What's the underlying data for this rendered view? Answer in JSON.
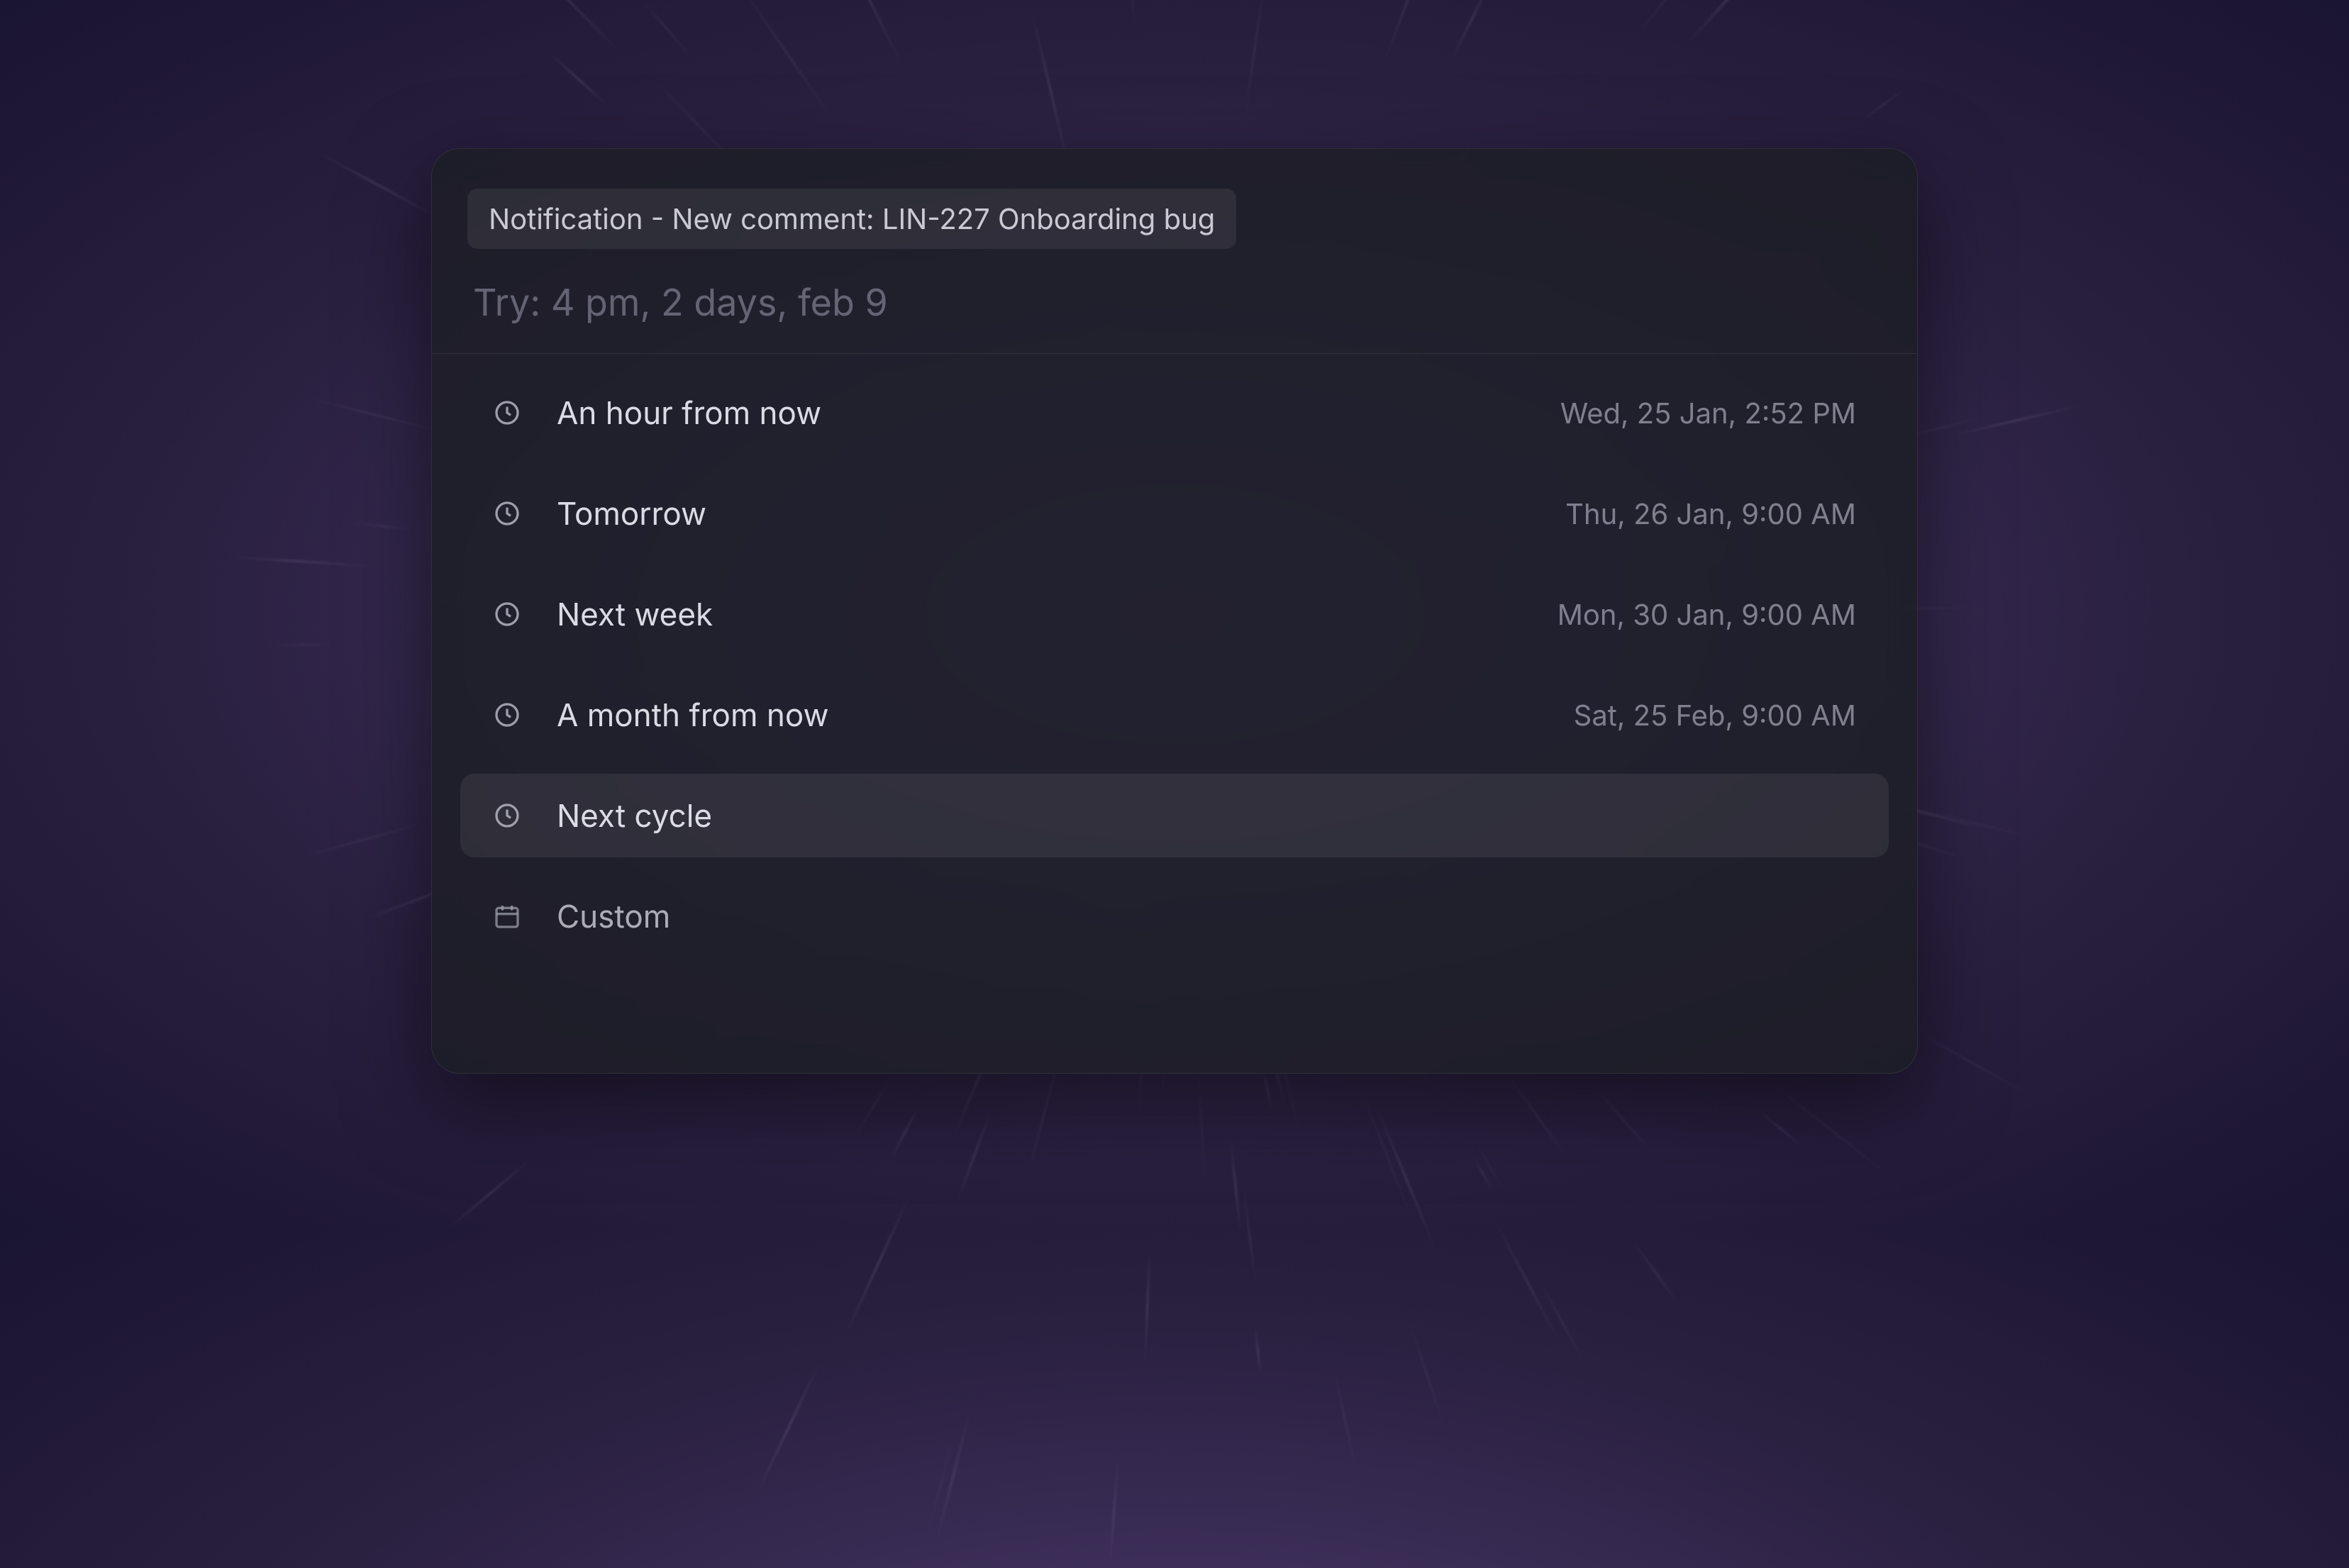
{
  "context_badge": "Notification - New comment: LIN-227 Onboarding bug",
  "search": {
    "placeholder": "Try: 4 pm, 2 days, feb 9",
    "value": ""
  },
  "options": [
    {
      "icon": "clock",
      "label": "An hour from now",
      "date": "Wed, 25 Jan, 2:52 PM",
      "selected": false
    },
    {
      "icon": "clock",
      "label": "Tomorrow",
      "date": "Thu, 26 Jan, 9:00 AM",
      "selected": false
    },
    {
      "icon": "clock",
      "label": "Next week",
      "date": "Mon, 30 Jan, 9:00 AM",
      "selected": false
    },
    {
      "icon": "clock",
      "label": "A month from now",
      "date": "Sat, 25 Feb, 9:00 AM",
      "selected": false
    },
    {
      "icon": "clock",
      "label": "Next cycle",
      "date": "",
      "selected": true
    },
    {
      "icon": "calendar",
      "label": "Custom",
      "date": "",
      "selected": false,
      "partial": true
    }
  ]
}
